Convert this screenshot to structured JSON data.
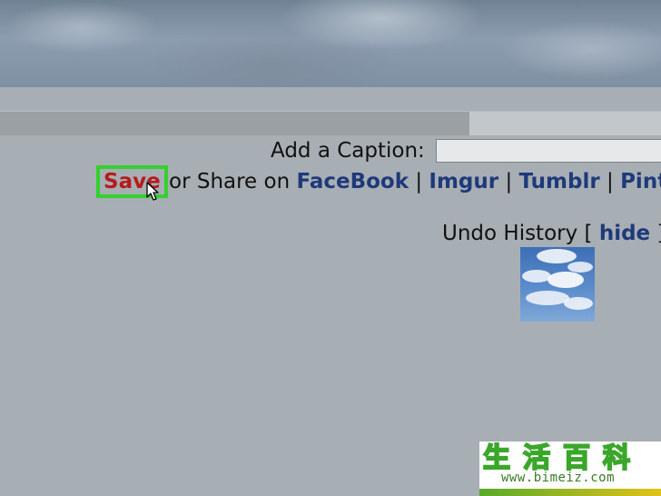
{
  "caption": {
    "label": "Add a Caption:",
    "input_value": "",
    "input_placeholder": ""
  },
  "share": {
    "save_label": "Save",
    "or_share_text": "or Share on",
    "links": [
      "FaceBook",
      "Imgur",
      "Tumblr",
      "Pinte"
    ],
    "separator": "|"
  },
  "undo": {
    "prefix": "Undo History [",
    "hide_label": "hide",
    "suffix": "]"
  },
  "progress": {
    "fraction": 0.71
  },
  "watermark": {
    "logo_text": "生活百科",
    "url": "www.bimeiz.com"
  },
  "icons": {
    "cursor": "cursor-arrow-icon",
    "thumbnail": "cloud-sky-thumbnail"
  },
  "colors": {
    "save_text": "#b51b1b",
    "save_border": "#33d02e",
    "link": "#1f3a7a",
    "page_bg": "#a8afb4"
  }
}
